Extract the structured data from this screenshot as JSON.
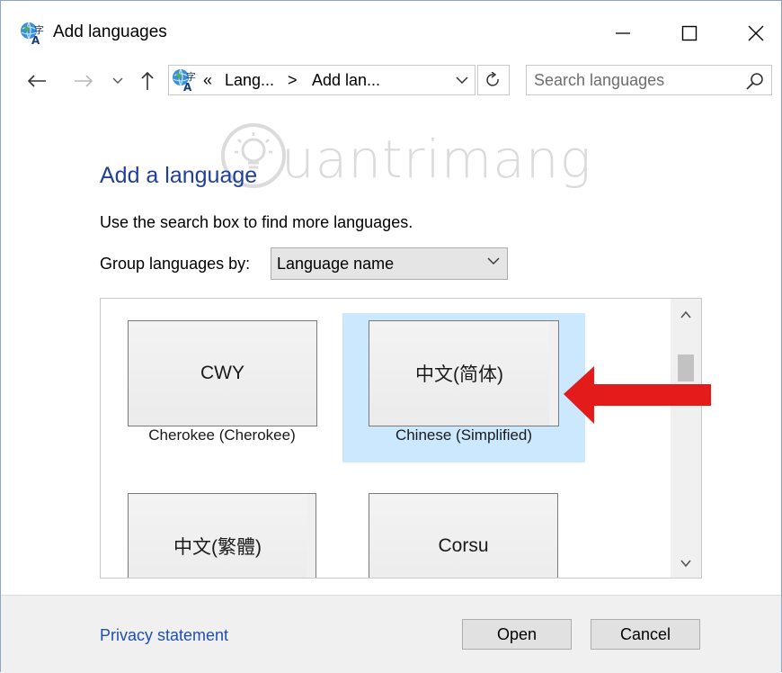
{
  "window": {
    "title": "Add languages",
    "minimize_icon": "minimize-icon",
    "maximize_icon": "maximize-icon",
    "close_icon": "close-icon"
  },
  "address_bar": {
    "overflow": "«",
    "crumbs": [
      "Lang...",
      "Add lan..."
    ],
    "separator": ">",
    "search_placeholder": "Search languages"
  },
  "watermark": {
    "text": "uantrimang"
  },
  "content": {
    "heading": "Add a language",
    "hint": "Use the search box to find more languages.",
    "group_label": "Group languages by:",
    "group_value": "Language name"
  },
  "languages": [
    {
      "tile_text": "CWY",
      "caption": "Cherokee (Cherokee)",
      "selected": false
    },
    {
      "tile_text": "中文(简体)",
      "caption": "Chinese (Simplified)",
      "selected": true
    },
    {
      "tile_text": "中文(繁體)",
      "caption": "",
      "selected": false
    },
    {
      "tile_text": "Corsu",
      "caption": "",
      "selected": false
    }
  ],
  "footer": {
    "privacy": "Privacy statement",
    "open": "Open",
    "cancel": "Cancel"
  },
  "colors": {
    "heading": "#1f3f9a",
    "link": "#1f4fb0",
    "selection": "#cce8ff",
    "arrow": "#e31b1b"
  }
}
